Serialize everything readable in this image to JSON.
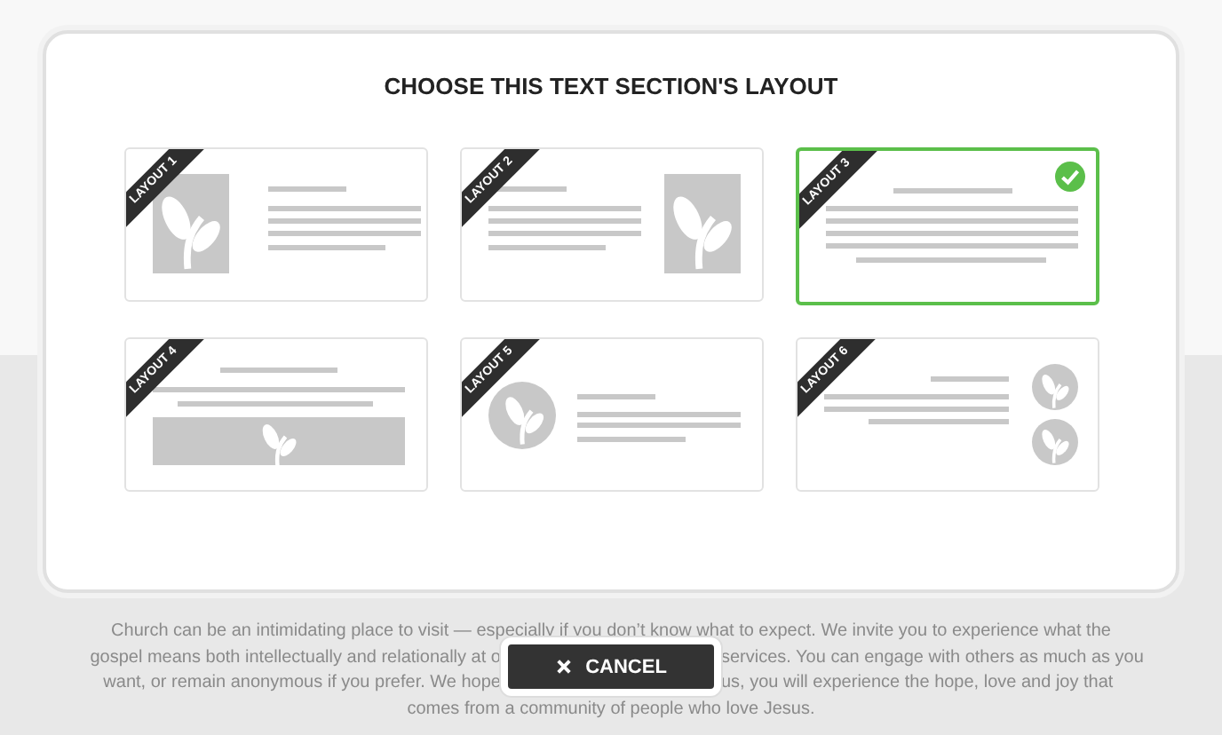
{
  "dialog": {
    "title": "CHOOSE THIS TEXT SECTION'S LAYOUT",
    "layouts": [
      {
        "label": "LAYOUT 1",
        "kind": "image-left",
        "selected": false
      },
      {
        "label": "LAYOUT 2",
        "kind": "image-right",
        "selected": false
      },
      {
        "label": "LAYOUT 3",
        "kind": "text-only",
        "selected": true
      },
      {
        "label": "LAYOUT 4",
        "kind": "banner-bottom",
        "selected": false
      },
      {
        "label": "LAYOUT 5",
        "kind": "circle-left",
        "selected": false
      },
      {
        "label": "LAYOUT 6",
        "kind": "circles-right",
        "selected": false
      }
    ]
  },
  "cancel_button": {
    "label": "CANCEL"
  },
  "background_text": {
    "lines": [
      {
        "parts": [
          "Church can be an intimidating place to visit — especially if you don’t know what to expect. We invite you to experience what the"
        ]
      },
      {
        "parts": [
          "gospel means both intellectually and relationally at o",
          "services. You can engage with others as much as you"
        ]
      },
      {
        "parts": [
          "want, or remain anonymous if you prefer. We hope",
          "us, you will experience the hope, love and joy that"
        ]
      },
      {
        "parts": [
          "comes from a community of people who love Jesus."
        ]
      }
    ]
  }
}
